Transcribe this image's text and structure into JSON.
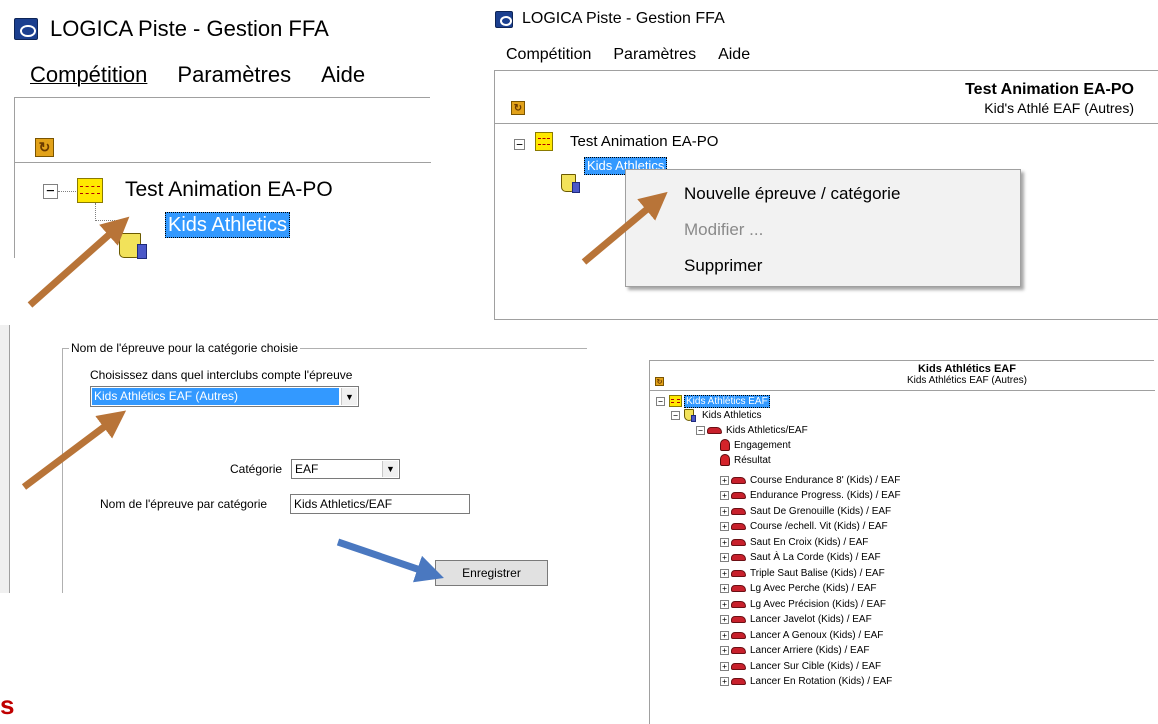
{
  "app_title": "LOGICA Piste - Gestion FFA",
  "menu": {
    "competition": "Compétition",
    "parametres": "Paramètres",
    "aide": "Aide"
  },
  "tree_root": "Test Animation EA-PO",
  "tree_child": "Kids Athletics",
  "header": {
    "title": "Test Animation EA-PO",
    "subtitle": "Kid's Athlé EAF (Autres)"
  },
  "context_menu": {
    "new_item": "Nouvelle épreuve / catégorie",
    "modify": "Modifier ...",
    "delete": "Supprimer"
  },
  "form": {
    "legend": "Nom de l'épreuve pour la catégorie choisie",
    "interclubs_label": "Choisissez dans quel interclubs compte l'épreuve",
    "interclubs_value": "Kids Athlétics EAF (Autres)",
    "category_label": "Catégorie",
    "category_value": "EAF",
    "name_label": "Nom de l'épreuve par catégorie",
    "name_value": "Kids Athletics/EAF",
    "save": "Enregistrer"
  },
  "result": {
    "title": "Kids Athlétics EAF",
    "subtitle": "Kids Athlétics EAF (Autres)",
    "root": "Kids Athlétics EAF",
    "child": "Kids Athletics",
    "group": "Kids Athletics/EAF",
    "engagement": "Engagement",
    "resultat": "Résultat",
    "events": [
      "Course Endurance 8' (Kids) / EAF",
      "Endurance Progress. (Kids) / EAF",
      "Saut De Grenouille (Kids) / EAF",
      "Course /echell. Vit (Kids) / EAF",
      "Saut En Croix (Kids) / EAF",
      "Saut À La Corde (Kids) / EAF",
      "Triple Saut Balise (Kids) / EAF",
      "Lg Avec Perche (Kids) / EAF",
      "Lg Avec Précision  (Kids) / EAF",
      "Lancer Javelot (Kids) / EAF",
      "Lancer A Genoux (Kids) / EAF",
      "Lancer Arriere  (Kids) / EAF",
      "Lancer Sur Cible (Kids) / EAF",
      "Lancer En Rotation (Kids) / EAF"
    ]
  },
  "bottom_fragment": "s",
  "colors": {
    "arrow_brown": "#b87438",
    "arrow_blue": "#4a78c0",
    "selection": "#3399ff"
  }
}
